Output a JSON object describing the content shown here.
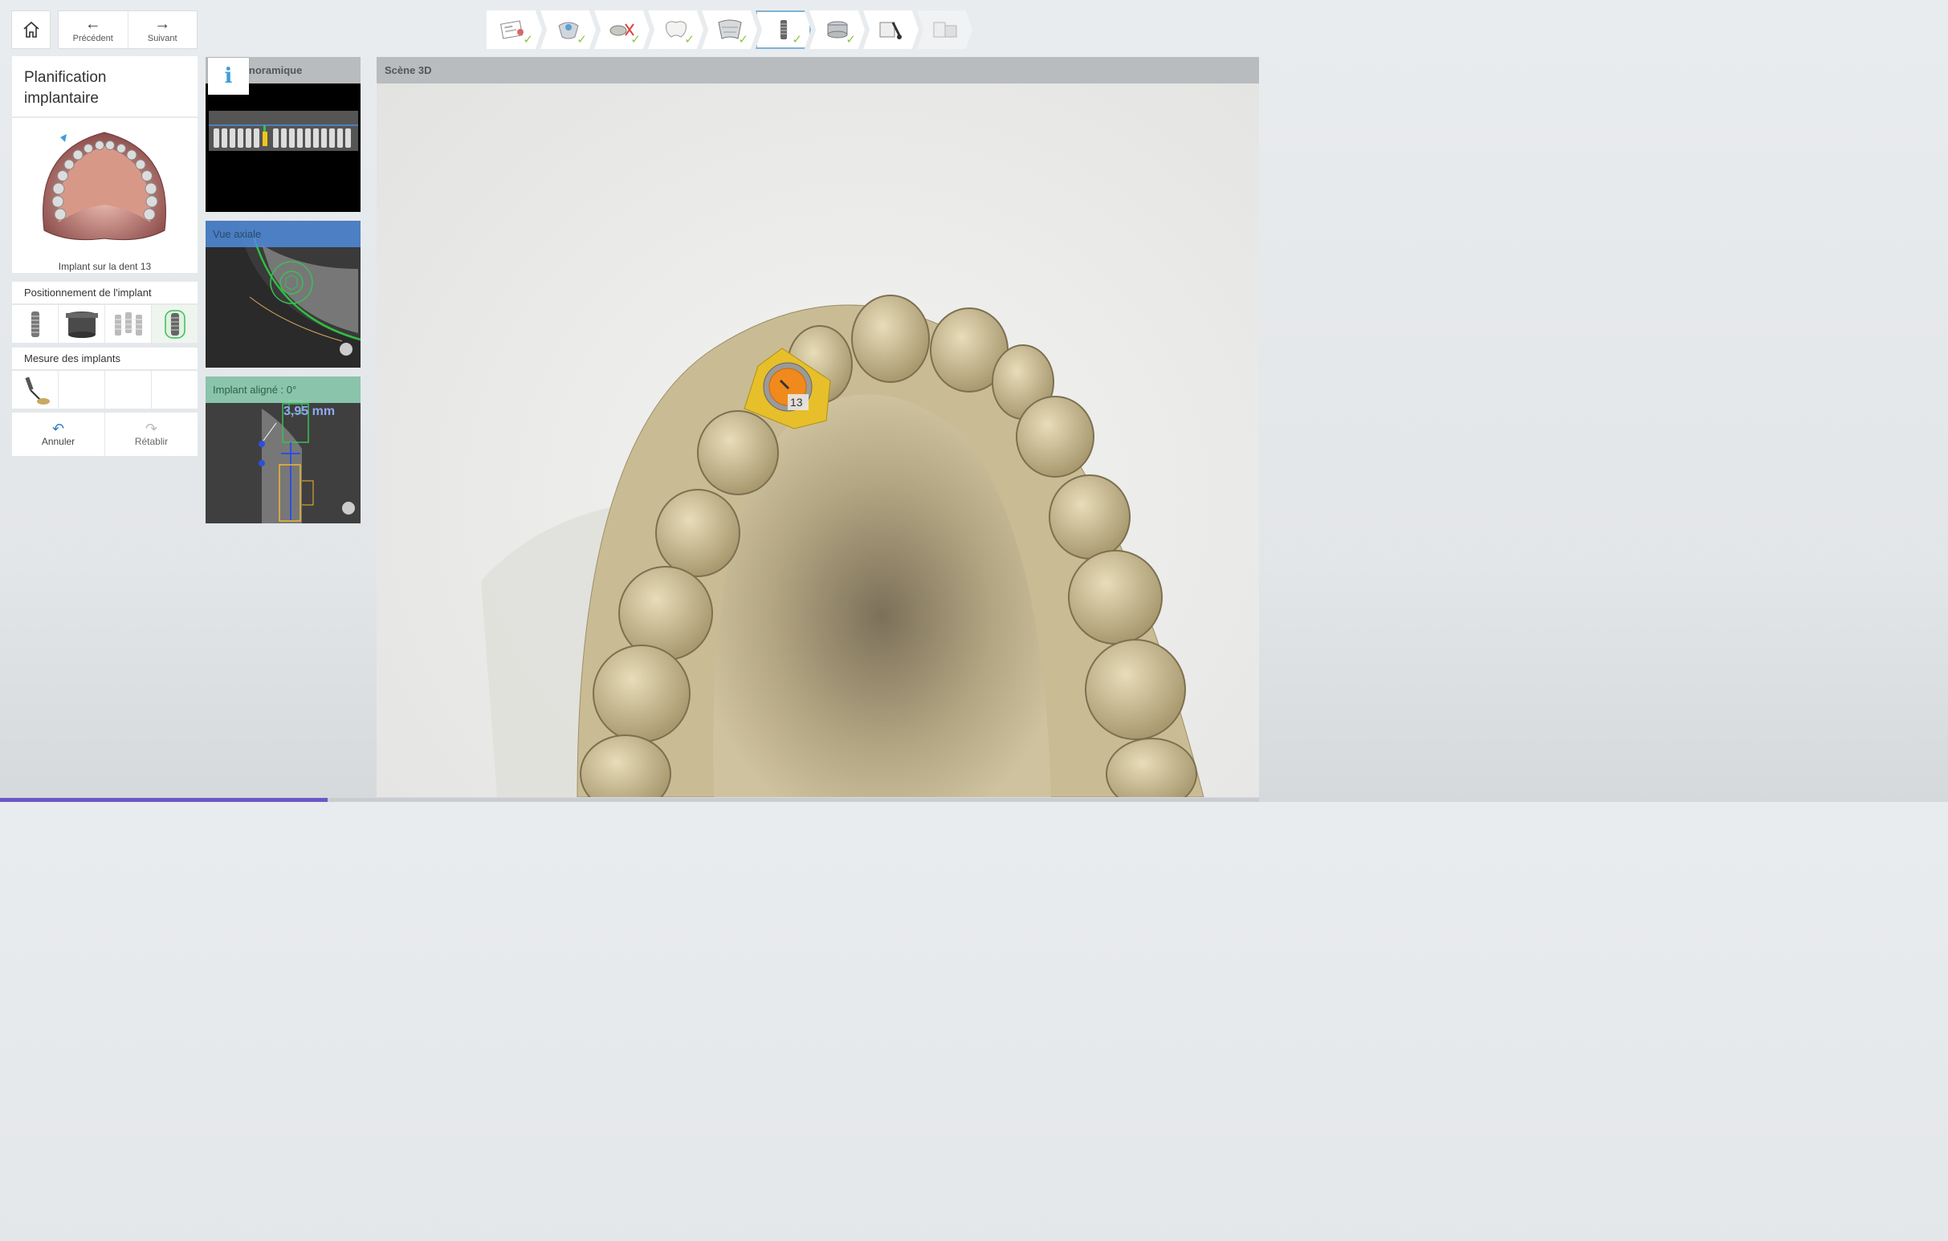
{
  "nav": {
    "prev_label": "Précédent",
    "next_label": "Suivant"
  },
  "steps": [
    {
      "icon": "patient-form-icon",
      "done": true
    },
    {
      "icon": "scan-import-icon",
      "done": true
    },
    {
      "icon": "cut-tools-icon",
      "done": true
    },
    {
      "icon": "crown-icon",
      "done": true
    },
    {
      "icon": "ct-scan-jaw-icon",
      "done": true
    },
    {
      "icon": "implant-icon",
      "done": true,
      "active": true
    },
    {
      "icon": "sleeve-icon",
      "done": true
    },
    {
      "icon": "guide-design-icon",
      "done": false
    },
    {
      "icon": "export-icon",
      "done": false,
      "disabled": true
    }
  ],
  "panel": {
    "title_line1": "Planification",
    "title_line2": "implantaire",
    "arch_caption": "Implant sur la dent 13",
    "positioning_label": "Positionnement de l'implant",
    "measure_label": "Mesure des implants",
    "undo_label": "Annuler",
    "redo_label": "Rétablir"
  },
  "views": {
    "panoramic": "Panoramique",
    "axial": "Vue axiale",
    "aligned": "Implant aligné : 0°",
    "measurement": "3,95 mm"
  },
  "scene": {
    "title": "Scène 3D",
    "tooth_number": "13"
  },
  "progress_fraction": 0.26,
  "colors": {
    "implant": "#f0b632",
    "accent": "#8cc63f",
    "progress": "#6b57c8"
  }
}
